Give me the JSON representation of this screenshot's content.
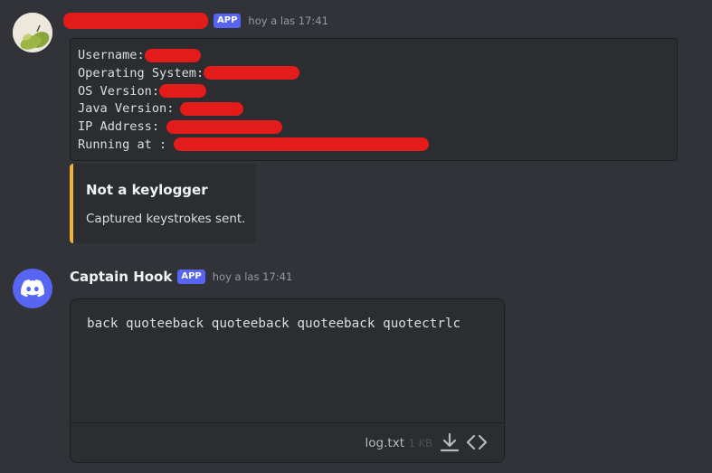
{
  "message1": {
    "app_tag": "APP",
    "timestamp": "hoy a las 17:41",
    "code_lines": [
      {
        "label": "Username:"
      },
      {
        "label": "Operating System:"
      },
      {
        "label": "OS Version:"
      },
      {
        "label": "Java Version:"
      },
      {
        "label": "IP Address:"
      },
      {
        "label": "Running at :"
      }
    ],
    "embed": {
      "title": "Not a keylogger",
      "description": "Captured keystrokes sent.",
      "accent_color": "#f0b232"
    }
  },
  "message2": {
    "username": "Captain Hook",
    "app_tag": "APP",
    "timestamp": "hoy a las 17:41",
    "attachment": {
      "content": "back quoteeback quoteeback quoteeback quotectrlc",
      "file_name": "log.txt",
      "file_size": "1 KB",
      "download_icon": "download-icon",
      "code_icon": "code-icon"
    }
  },
  "colors": {
    "background": "#313338",
    "blurple": "#5865f2",
    "redaction": "#e31b1b"
  }
}
